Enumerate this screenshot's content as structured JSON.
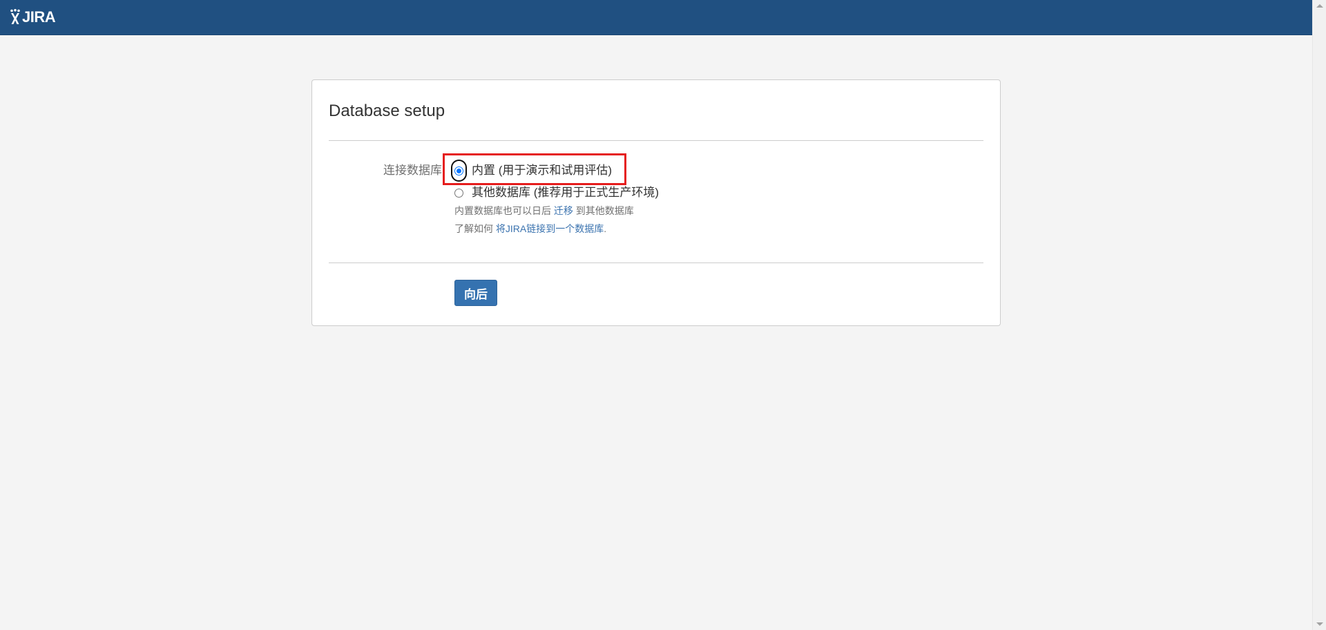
{
  "header": {
    "logo_text": "JIRA",
    "background_color": "#205081"
  },
  "panel": {
    "title": "Database setup",
    "field_label": "连接数据库",
    "options": [
      {
        "label": "内置 (用于演示和试用评估)",
        "checked": true
      },
      {
        "label": "其他数据库 (推荐用于正式生产环境)",
        "checked": false
      }
    ],
    "migrate_note": {
      "before": "内置数据库也可以日后 ",
      "link": "迁移",
      "after": " 到其他数据库"
    },
    "learn_note": {
      "before": "了解如何 ",
      "link": "将JIRA链接到一个数据库",
      "after": "."
    },
    "next_button_label": "向后"
  },
  "colors": {
    "accent": "#3572b0",
    "link": "#3b73af",
    "highlight": "#e51c1c",
    "radio_checked": "#0075ff"
  }
}
